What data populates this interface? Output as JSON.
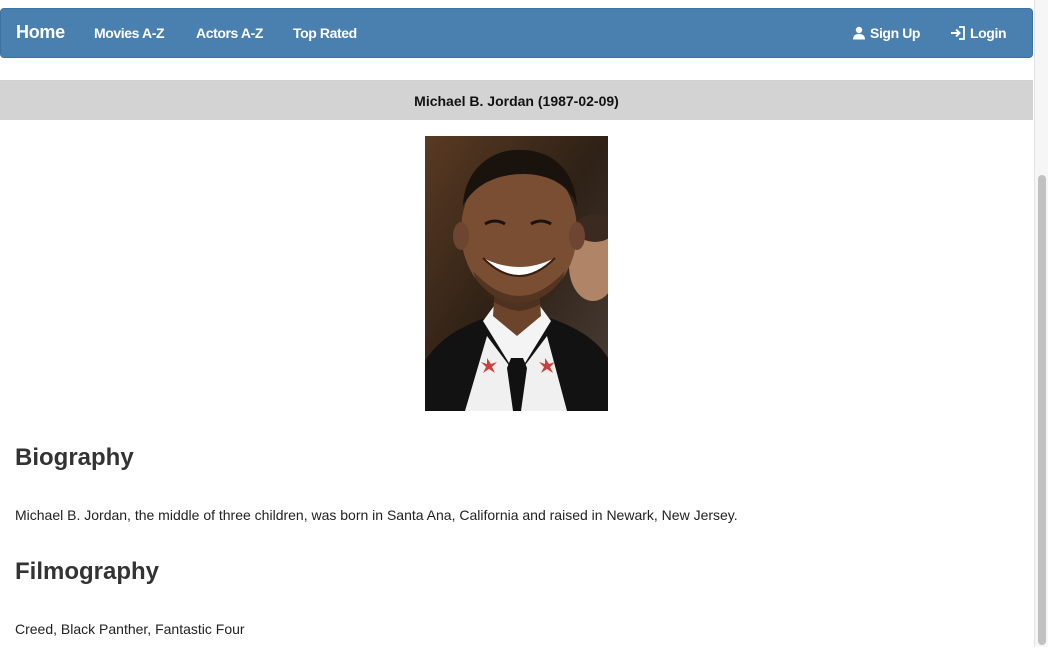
{
  "navbar": {
    "brand": "Home",
    "links": [
      "Movies A-Z",
      "Actors A-Z",
      "Top Rated"
    ],
    "signup_label": "Sign Up",
    "login_label": "Login",
    "background_color": "#4a80b0",
    "signup_icon": "user-icon",
    "login_icon": "login-icon"
  },
  "actor": {
    "heading": "Michael B. Jordan (1987-02-09)",
    "photo_alt": "Michael B. Jordan"
  },
  "biography": {
    "title": "Biography",
    "text": "Michael B. Jordan, the middle of three children, was born in Santa Ana, California and raised in Newark, New Jersey."
  },
  "filmography": {
    "title": "Filmography",
    "text": "Creed, Black Panther, Fantastic Four"
  }
}
